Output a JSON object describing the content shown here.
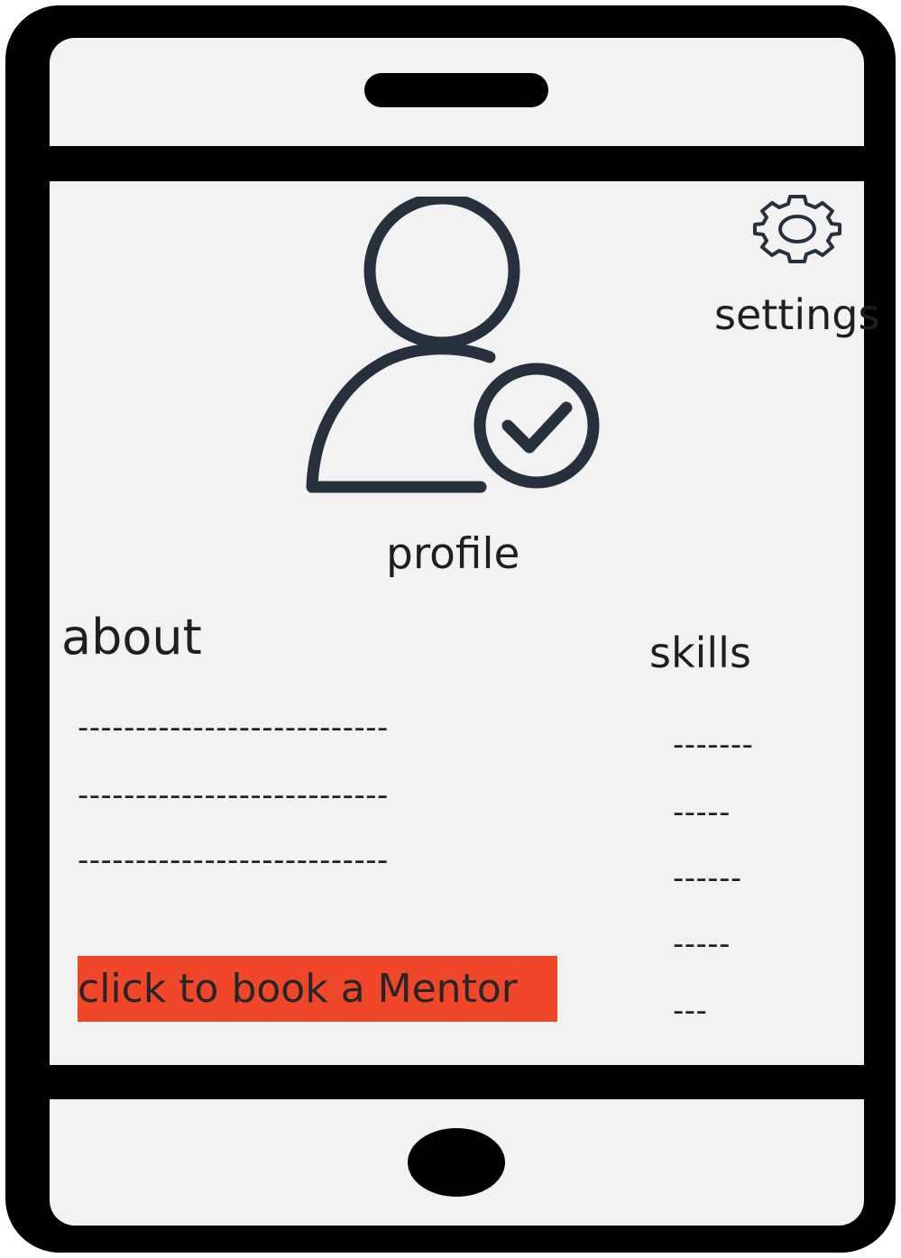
{
  "settings": {
    "label": "settings",
    "icon": "gear-icon"
  },
  "profile": {
    "label": "profile",
    "icon": "verified-user-icon"
  },
  "about": {
    "title": "about",
    "lines": [
      "---------------------------",
      "---------------------------",
      "---------------------------"
    ]
  },
  "skills": {
    "title": "skills",
    "items": [
      "-------",
      "-----",
      "------",
      "-----",
      "---"
    ]
  },
  "book_button": {
    "label": "click to book a Mentor",
    "color": "#f0462a"
  },
  "colors": {
    "frame": "#000000",
    "screen": "#f2f2f2",
    "icon_stroke": "#27313e",
    "text": "#1f1f1f"
  }
}
